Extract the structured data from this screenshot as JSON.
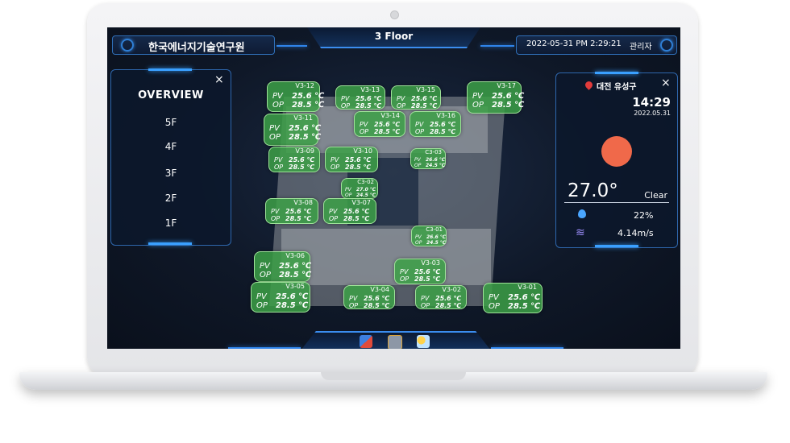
{
  "header": {
    "organization": "한국에너지기술연구원",
    "floor_title": "3 Floor",
    "datetime": "2022-05-31 PM 2:29:21",
    "user": "관리자"
  },
  "menu": {
    "title": "OVERVIEW",
    "close": "×",
    "items": [
      "5F",
      "4F",
      "3F",
      "2F",
      "1F"
    ]
  },
  "sensors": [
    {
      "id": "V3-12",
      "pv_label": "PV",
      "pv": "25.6 ℃",
      "op_label": "OP",
      "op": "28.5 ℃"
    },
    {
      "id": "V3-13",
      "pv_label": "PV",
      "pv": "25.6 ℃",
      "op_label": "OP",
      "op": "28.5 ℃"
    },
    {
      "id": "V3-15",
      "pv_label": "PV",
      "pv": "25.6 ℃",
      "op_label": "OP",
      "op": "28.5 ℃"
    },
    {
      "id": "V3-17",
      "pv_label": "PV",
      "pv": "25.6 ℃",
      "op_label": "OP",
      "op": "28.5 ℃"
    },
    {
      "id": "V3-11",
      "pv_label": "PV",
      "pv": "25.6 ℃",
      "op_label": "OP",
      "op": "28.5 ℃"
    },
    {
      "id": "V3-14",
      "pv_label": "PV",
      "pv": "25.6 ℃",
      "op_label": "OP",
      "op": "28.5 ℃"
    },
    {
      "id": "V3-16",
      "pv_label": "PV",
      "pv": "25.6 ℃",
      "op_label": "OP",
      "op": "28.5 ℃"
    },
    {
      "id": "V3-09",
      "pv_label": "PV",
      "pv": "25.6 ℃",
      "op_label": "OP",
      "op": "28.5 ℃"
    },
    {
      "id": "V3-10",
      "pv_label": "PV",
      "pv": "25.6 ℃",
      "op_label": "OP",
      "op": "28.5 ℃"
    },
    {
      "id": "C3-03",
      "pv_label": "PV",
      "pv": "26.6 ℃",
      "op_label": "OP",
      "op": "24.5 ℃"
    },
    {
      "id": "C3-02",
      "pv_label": "PV",
      "pv": "27.0 ℃",
      "op_label": "OP",
      "op": "24.5 ℃"
    },
    {
      "id": "V3-08",
      "pv_label": "PV",
      "pv": "25.6 ℃",
      "op_label": "OP",
      "op": "28.5 ℃"
    },
    {
      "id": "V3-07",
      "pv_label": "PV",
      "pv": "25.6 ℃",
      "op_label": "OP",
      "op": "28.5 ℃"
    },
    {
      "id": "C3-01",
      "pv_label": "PV",
      "pv": "26.6 ℃",
      "op_label": "OP",
      "op": "24.5 ℃"
    },
    {
      "id": "V3-06",
      "pv_label": "PV",
      "pv": "25.6 ℃",
      "op_label": "OP",
      "op": "28.5 ℃"
    },
    {
      "id": "V3-03",
      "pv_label": "PV",
      "pv": "25.6 ℃",
      "op_label": "OP",
      "op": "28.5 ℃"
    },
    {
      "id": "V3-05",
      "pv_label": "PV",
      "pv": "25.6 ℃",
      "op_label": "OP",
      "op": "28.5 ℃"
    },
    {
      "id": "V3-04",
      "pv_label": "PV",
      "pv": "25.6 ℃",
      "op_label": "OP",
      "op": "28.5 ℃"
    },
    {
      "id": "V3-02",
      "pv_label": "PV",
      "pv": "25.6 ℃",
      "op_label": "OP",
      "op": "28.5 ℃"
    },
    {
      "id": "V3-01",
      "pv_label": "PV",
      "pv": "25.6 ℃",
      "op_label": "OP",
      "op": "28.5 ℃"
    }
  ],
  "weather": {
    "location": "대전 유성구",
    "close": "×",
    "time": "14:29",
    "date": "2022.05.31",
    "temperature": "27.0°",
    "condition": "Clear",
    "humidity": "22%",
    "wind": "4.14m/s",
    "condition_icon": "sun-icon",
    "sun_color": "#f0694a"
  },
  "toolbar": {
    "icons": [
      "map-icon",
      "camera-icon",
      "weather-icon"
    ]
  },
  "colors": {
    "accent": "#2f84ea",
    "sensor_green": "#3ca046"
  }
}
